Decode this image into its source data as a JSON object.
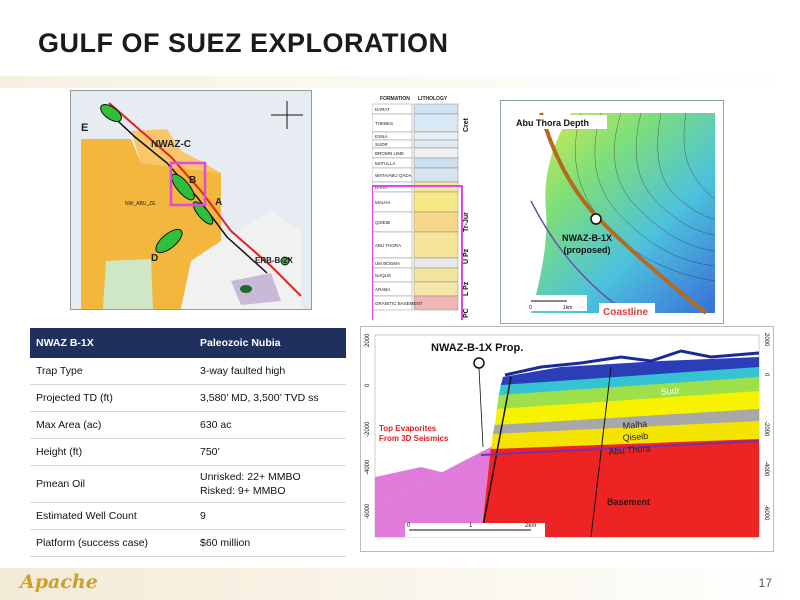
{
  "slide": {
    "title": "GULF OF SUEZ EXPLORATION",
    "page_number": "17",
    "logo_text": "Apache",
    "accent": "#20305e"
  },
  "map": {
    "labels": {
      "nwaz_c": "NWAZ-C",
      "block_e": "E",
      "block_b": "B",
      "block_a": "A",
      "block_d": "D",
      "erb": "ERB-B-2X",
      "nw_abu_ze": "NW_ABU_ZE"
    }
  },
  "stratigraphy": {
    "header_formation": "FORMATION",
    "header_lithology": "LITHOLOGY",
    "formations": [
      "DARAT",
      "THEBES",
      "ESNA",
      "SUDR",
      "BROWN LIME",
      "MATULLA",
      "WATA/ABU QADA",
      "RAHA",
      "MALHA",
      "QISEIB",
      "ABU THORA",
      "UM BOGMA",
      "NAQUS",
      "ARABA",
      "GRANITIC BASEMENT"
    ],
    "age_labels": [
      "Cret",
      "Tr-Jur",
      "U Pz",
      "L Pz",
      "PC"
    ]
  },
  "depth_map": {
    "title": "Abu Thora Depth",
    "well_label_1": "NWAZ-B-1X",
    "well_label_2": "(proposed)",
    "coastline": "Coastline",
    "scale_0": "0",
    "scale_1": "1km"
  },
  "section": {
    "title": "NWAZ-B-1X Prop.",
    "annotation_1": "Top Evaporites",
    "annotation_2": "From 3D Seismics",
    "layers": {
      "sudr": "Sudr",
      "malha": "Malha",
      "qiseib": "Qiseib",
      "abu_thora": "Abu Thora",
      "basement": "Basement"
    },
    "left_ticks": [
      "2000",
      "0",
      "-2000",
      "-4000",
      "-6000"
    ],
    "right_ticks": [
      "2000",
      "0",
      "-2000",
      "-4000",
      "-6000"
    ],
    "scale": [
      "0",
      "1",
      "2km"
    ]
  },
  "table": {
    "header": [
      "NWAZ B-1X",
      "Paleozoic Nubia"
    ],
    "rows": [
      {
        "label": "Trap Type",
        "value": "3-way faulted high"
      },
      {
        "label": "Projected TD (ft)",
        "value": "3,580’ MD, 3,500’ TVD ss"
      },
      {
        "label": "Max Area (ac)",
        "value": "630 ac"
      },
      {
        "label": "Height (ft)",
        "value": "750’"
      },
      {
        "label": "Pmean Oil",
        "value_1": "Unrisked: 22+ MMBO",
        "value_2": "Risked: 9+ MMBO"
      },
      {
        "label": "Estimated Well Count",
        "value": "9"
      },
      {
        "label": "Platform (success case)",
        "value": "$60 million"
      }
    ]
  }
}
